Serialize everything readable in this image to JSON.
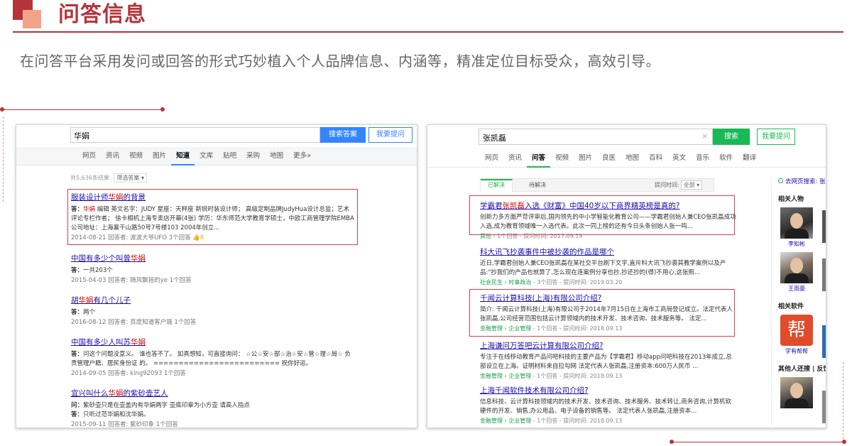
{
  "slide": {
    "title": "问答信息",
    "subtitle": "在问答平台采用发问或回答的形式巧妙植入个人品牌信息、内涵等，精准定位目标受众，高效引导。"
  },
  "colors": {
    "accent": "#b5343a",
    "accent_light": "#f2a48b",
    "baidu_blue": "#3385ff",
    "so_green": "#19b955",
    "link": "#1a0dab",
    "keyword": "#cc0000"
  },
  "shot1": {
    "query": "华娟",
    "search_btn": "搜索答案",
    "ask_btn": "我要提问",
    "nav": [
      "网页",
      "资讯",
      "视频",
      "图片",
      "知道",
      "文库",
      "贴吧",
      "采购",
      "地图",
      "更多»"
    ],
    "active_nav": "知道",
    "result_count": "共5,636条结果",
    "filter": "筛选答案 ▾",
    "results": [
      {
        "title_pre": "服装设计师",
        "title_kw": "华娟",
        "title_post": "的背景",
        "ans_label": "答：",
        "ans_kw": "华娟",
        "ans_text": " 编辑 英文名字：JUDY 星座：天秤座 新锐时装设计师； 高级定制品牌JudyHua设计总监；艺术评论专栏作者； 徐卡相机上海专卖店开幕(4张) 学历：华东师范大学教育学硕士，中欧工商管理学院EMBA 公司地址：上海襄干山路50号7号楼103 2004年创立...",
        "meta": "2014-08-21   回答者: 波波大爷UFO   3个回答",
        "likes": "6"
      },
      {
        "title_pre": "中国有多少个叫曾",
        "title_kw": "华娟",
        "title_post": "",
        "ans_label": "答：",
        "ans_text": "一共203个",
        "meta": "2015-04-03   回答者: 随风飘摇的ye   1个回答"
      },
      {
        "title_pre": "胡",
        "title_kw": "华娟",
        "title_post": "有几个儿子",
        "ans_label": "答：",
        "ans_text": "两个",
        "meta": "2016-08-12   回答者: 百度知道客户端   1个回答"
      },
      {
        "title_pre": "中国有多少人叫苏",
        "title_kw": "华娟",
        "title_post": "",
        "ans_label": "答：",
        "ans_text": "问这个问题没意义。 谁也答不了。 如真想知，可直接询问： ☆公☆安☆部☆治☆安☆管☆理☆局☆ 负责管理户籍、居民身份证 的。 ========================= 祝你好运。",
        "meta": "2014-09-05   回答者: king92093   1个回答"
      },
      {
        "title_pre": "宜兴叫什么",
        "title_kw": "华娟",
        "title_post": "的紫砂壶艺人",
        "ans_label": "问：",
        "ans_text": "紫砂壶只是在壶盖内有华娟两字 壶底印章为小方壶 请高人指点",
        "ans2_label": "答：",
        "ans2_text": "只听过范华娟和沈华娟。",
        "meta": "2015-09-11   回答者: 紫砂印象   1个回答"
      }
    ]
  },
  "shot2": {
    "query": "张凯磊",
    "clear": "×",
    "search_btn": "搜索",
    "ask_btn": "我要提问",
    "nav": [
      "网页",
      "资讯",
      "问答",
      "视频",
      "图片",
      "良医",
      "地图",
      "百科",
      "英文",
      "音乐",
      "软件",
      "翻译"
    ],
    "active_nav": "问答",
    "tab_solved": "已解决",
    "tab_pending": "待解决",
    "time_label": "提问时间:",
    "time_value": "全部 ▾",
    "results": [
      {
        "title_pre": "学霸君",
        "title_kw": "张凯磊",
        "title_post": "入选《财富》中国40岁以下商界精英榜是真的?",
        "snippet": "创新力多方面严苛评审后,国内领先的中小学智能化教育公司——学霸君创始人兼CEO张凯磊成功入选,成为教育领域唯一入选代表。此次一同上榜的还有今日头条创始人张一鸣...",
        "cat": "其他",
        "meta": " › 1个回答 - 提问时间: 2017.09.19"
      },
      {
        "title_pre": "科大讯飞抄袭事件中被抄袭的作品是哪个",
        "title_kw": "",
        "title_post": "",
        "snippet": "近日,学霸君创始人兼CEO张凯磊在某社交平台刷下文字,直斥科大讯飞抄袭其教学案例以及产品:\"抄我们的产品也就算了,怎么现在连案例分享也抄,抄还抄的(得)不用心,这张照...",
        "cat": "社会民生",
        "cat2": "时事政治",
        "meta": " - 3个回答 - 提问时间: 2019.03.20"
      },
      {
        "title_pre": "千闻云计算科技(上海)有限公司介绍?",
        "title_kw": "",
        "title_post": "",
        "snippet": "简介: 千闻云计算科技(上海)有限公司于2014年7月15日在上海市工商局登记成立。法定代表人张凯磊,公司经营范围包括云计算领域内的技术开发、技术咨询、技术服务等。 法定...",
        "cat": "金融管理",
        "cat2": "企业管理",
        "meta": " - 1个回答 - 提问时间: 2018.09.13"
      },
      {
        "title_pre": "上海谦问万答吧云计算有限公司介绍?",
        "title_kw": "",
        "title_post": "",
        "snippet": "专注于在线移动教育产品问吧科技的主要产品为【学霸君】移动app问吧科技在2013年成立,总部设立在上海。证明材料来自拉勾网 法定代表人张凯磊,注册资本:600万人民币 ...",
        "cat": "金融管理",
        "cat2": "企业管理",
        "meta": " - 1个回答 - 提问时间: 2018.09.13"
      },
      {
        "title_pre": "上海千闻软件技术有限公司介绍?",
        "title_kw": "",
        "title_post": "",
        "snippet": "信息科技、云计算科技领域内的技术开发、技术咨询、技术服务、技术转让,商务咨询,计算机软硬件的开发、销售,办公用品、电子设备的销售等。 法定代表人张凯磊,注册资本...",
        "cat": "金融管理",
        "cat2": "企业管理",
        "meta": " - 1个回答 - 提问时间: 2018.09.13"
      }
    ],
    "side": {
      "link": "去网页搜索: 张",
      "people_h": "相关人物",
      "person1": "李知彬",
      "person2": "王雨豪",
      "software_h": "相关软件",
      "app_glyph": "帮",
      "app_name": "学有帮帮",
      "others_h": "其他人还搜 | 反馈"
    }
  }
}
